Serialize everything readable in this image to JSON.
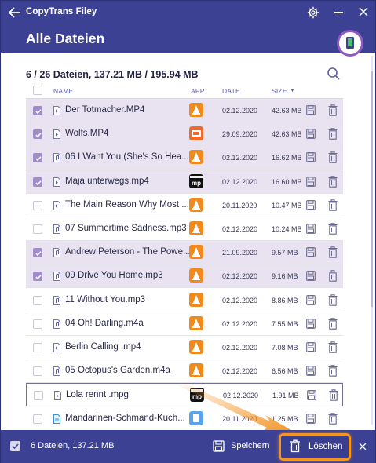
{
  "app": {
    "title": "CopyTrans Filey",
    "page_title": "Alle Dateien"
  },
  "summary": "6 / 26 Dateien, 137.21 MB / 195.94 MB",
  "columns": {
    "name": "NAME",
    "app": "APP",
    "date": "DATE",
    "size": "SIZE",
    "size_sort": "▼"
  },
  "rows": [
    {
      "name": "Der Totmacher.MP4",
      "date": "02.12.2020",
      "size": "42.63 MB",
      "selected": true,
      "type": "video",
      "app": "vlc"
    },
    {
      "name": "Wolfs.MP4",
      "date": "29.09.2020",
      "size": "42.63 MB",
      "selected": true,
      "type": "video",
      "app": "infuse"
    },
    {
      "name": "06 I Want You (She's So Hea...",
      "date": "02.12.2020",
      "size": "16.62 MB",
      "selected": true,
      "type": "audio",
      "app": "vlc"
    },
    {
      "name": "Maja unterwegs.mp4",
      "date": "02.12.2020",
      "size": "16.60 MB",
      "selected": true,
      "type": "video",
      "app": "mp"
    },
    {
      "name": "The Main Reason Why Most ...",
      "date": "20.11.2020",
      "size": "10.47 MB",
      "selected": false,
      "type": "video",
      "app": "vlc"
    },
    {
      "name": "07 Summertime Sadness.mp3",
      "date": "02.12.2020",
      "size": "10.24 MB",
      "selected": false,
      "type": "audio",
      "app": "vlc"
    },
    {
      "name": "Andrew Peterson - The Powe...",
      "date": "21.09.2020",
      "size": "9.57 MB",
      "selected": true,
      "type": "audio",
      "app": "vlc"
    },
    {
      "name": "09 Drive You Home.mp3",
      "date": "02.12.2020",
      "size": "9.16 MB",
      "selected": true,
      "type": "audio",
      "app": "vlc"
    },
    {
      "name": "11 Without You.mp3",
      "date": "02.12.2020",
      "size": "8.86 MB",
      "selected": false,
      "type": "audio",
      "app": "vlc"
    },
    {
      "name": "04 Oh! Darling.m4a",
      "date": "02.12.2020",
      "size": "7.55 MB",
      "selected": false,
      "type": "audio",
      "app": "vlc"
    },
    {
      "name": "Berlin Calling .mp4",
      "date": "02.12.2020",
      "size": "7.08 MB",
      "selected": false,
      "type": "video",
      "app": "vlc"
    },
    {
      "name": "05 Octopus's Garden.m4a",
      "date": "02.12.2020",
      "size": "6.56 MB",
      "selected": false,
      "type": "audio",
      "app": "vlc"
    },
    {
      "name": "Lola rennt .mpg",
      "date": "02.12.2020",
      "size": "1.91 MB",
      "selected": false,
      "type": "video",
      "app": "mp"
    },
    {
      "name": "Mandarinen-Schmand-Kuch...",
      "date": "20.11.2020",
      "size": "1.25 MB",
      "selected": false,
      "type": "doc",
      "app": "doc"
    }
  ],
  "footer": {
    "selection": "6 Dateien, 137.21 MB",
    "save_label": "Speichern",
    "delete_label": "Löschen"
  },
  "colors": {
    "header": "#3d4193",
    "selected_row": "#e9e3f1",
    "accent_orange": "#f39424",
    "device_ring": "#8f5bc3"
  }
}
